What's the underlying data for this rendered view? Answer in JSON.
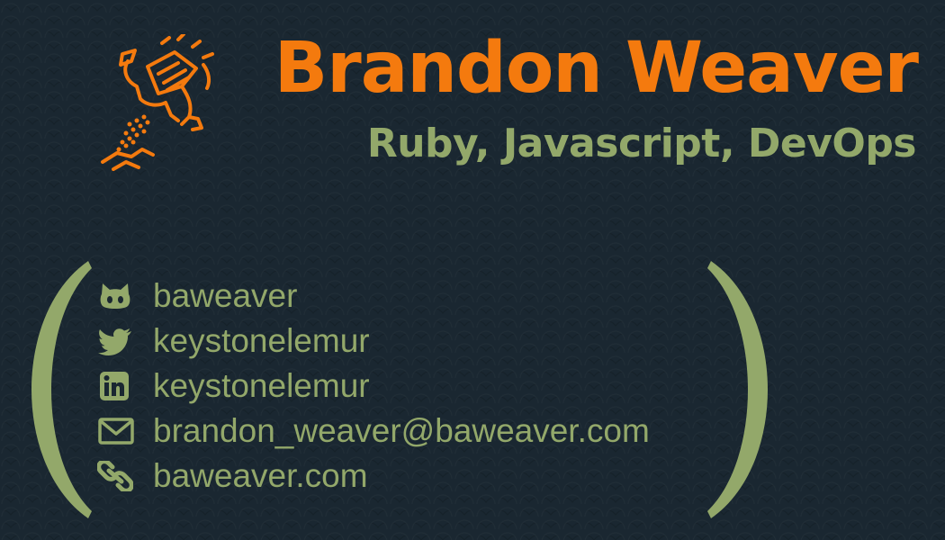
{
  "header": {
    "name": "Brandon Weaver",
    "skills": "Ruby, Javascript, DevOps"
  },
  "contacts": [
    {
      "icon": "github-icon",
      "text": "baweaver"
    },
    {
      "icon": "twitter-icon",
      "text": "keystonelemur"
    },
    {
      "icon": "linkedin-icon",
      "text": "keystonelemur"
    },
    {
      "icon": "email-icon",
      "text": "brandon_weaver@baweaver.com"
    },
    {
      "icon": "link-icon",
      "text": "baweaver.com"
    }
  ],
  "colors": {
    "background": "#1a2731",
    "accent_orange": "#f47a0e",
    "accent_green": "#93a86a"
  }
}
